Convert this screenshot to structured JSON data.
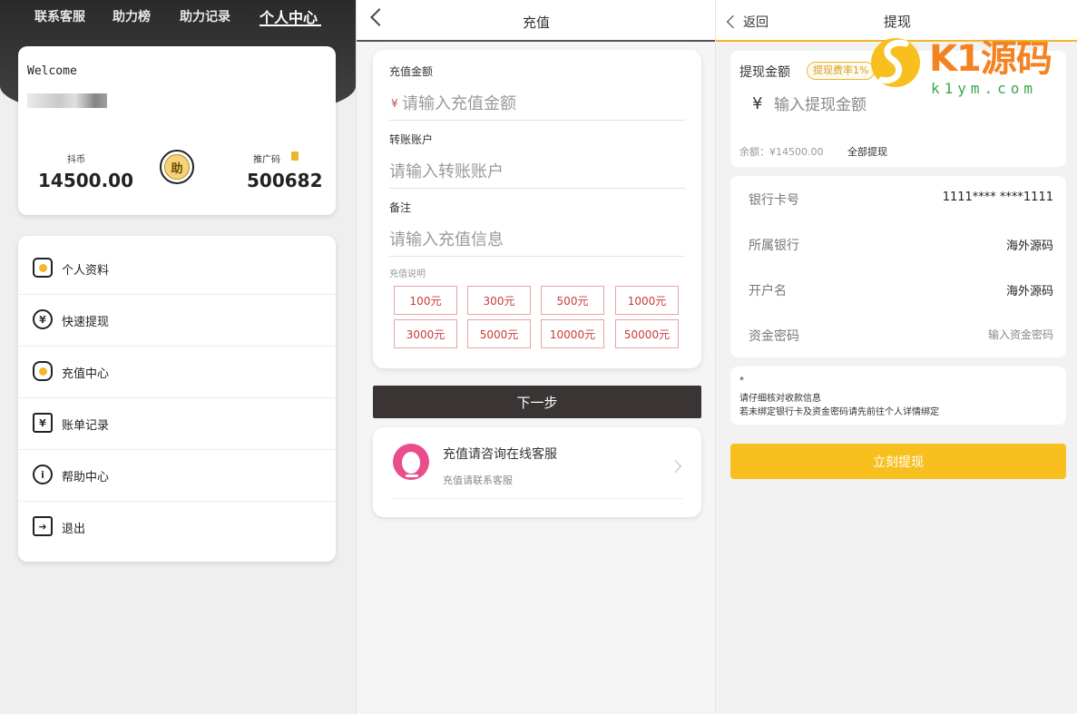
{
  "profile_panel": {
    "nav": [
      "联系客服",
      "助力榜",
      "助力记录",
      "个人中心"
    ],
    "welcome": "Welcome",
    "balance_label": "抖币",
    "balance_value": "14500.00",
    "coin_glyph": "助",
    "promo_label": "推广码",
    "promo_value": "500682",
    "menu": [
      {
        "label": "个人资料",
        "icon": "profile-icon"
      },
      {
        "label": "快速提现",
        "icon": "withdraw-icon"
      },
      {
        "label": "充值中心",
        "icon": "recharge-icon"
      },
      {
        "label": "账单记录",
        "icon": "bill-icon"
      },
      {
        "label": "帮助中心",
        "icon": "help-icon"
      },
      {
        "label": "退出",
        "icon": "logout-icon"
      }
    ]
  },
  "recharge_panel": {
    "title": "充值",
    "amount_label": "充值金额",
    "amount_prefix": "¥",
    "amount_placeholder": "请输入充值金额",
    "account_label": "转账账户",
    "account_placeholder": "请输入转账账户",
    "note_label": "备注",
    "note_placeholder": "请输入充值信息",
    "desc_label": "充值说明",
    "amounts": [
      "100元",
      "300元",
      "500元",
      "1000元",
      "3000元",
      "5000元",
      "10000元",
      "50000元"
    ],
    "next_button": "下一步",
    "cs_title": "充值请咨询在线客服",
    "cs_subtitle": "充值请联系客服"
  },
  "withdraw_panel": {
    "back_label": "返回",
    "title": "提现",
    "amount_label": "提现金额",
    "fee_badge": "提现费率1%",
    "currency": "¥",
    "amount_placeholder": "输入提现金额",
    "balance_text": "余额：¥14500.00",
    "withdraw_all": "全部提现",
    "bank_rows": [
      {
        "key": "银行卡号",
        "value": "1111**** ****1111"
      },
      {
        "key": "所属银行",
        "value": "海外源码"
      },
      {
        "key": "开户名",
        "value": "海外源码"
      }
    ],
    "password_label": "资金密码",
    "password_placeholder": "输入资金密码",
    "notes": [
      "*",
      "请仔细核对收款信息",
      "若未绑定银行卡及资金密码请先前往个人详情绑定"
    ],
    "submit_button": "立刻提现"
  },
  "watermark": {
    "brand": "K1源码",
    "domain": "k1ym.com"
  },
  "colors": {
    "accent": "#f7c01f",
    "dark": "#3a3434",
    "danger": "#c83a3a",
    "cs_pink": "#e94d8c"
  }
}
